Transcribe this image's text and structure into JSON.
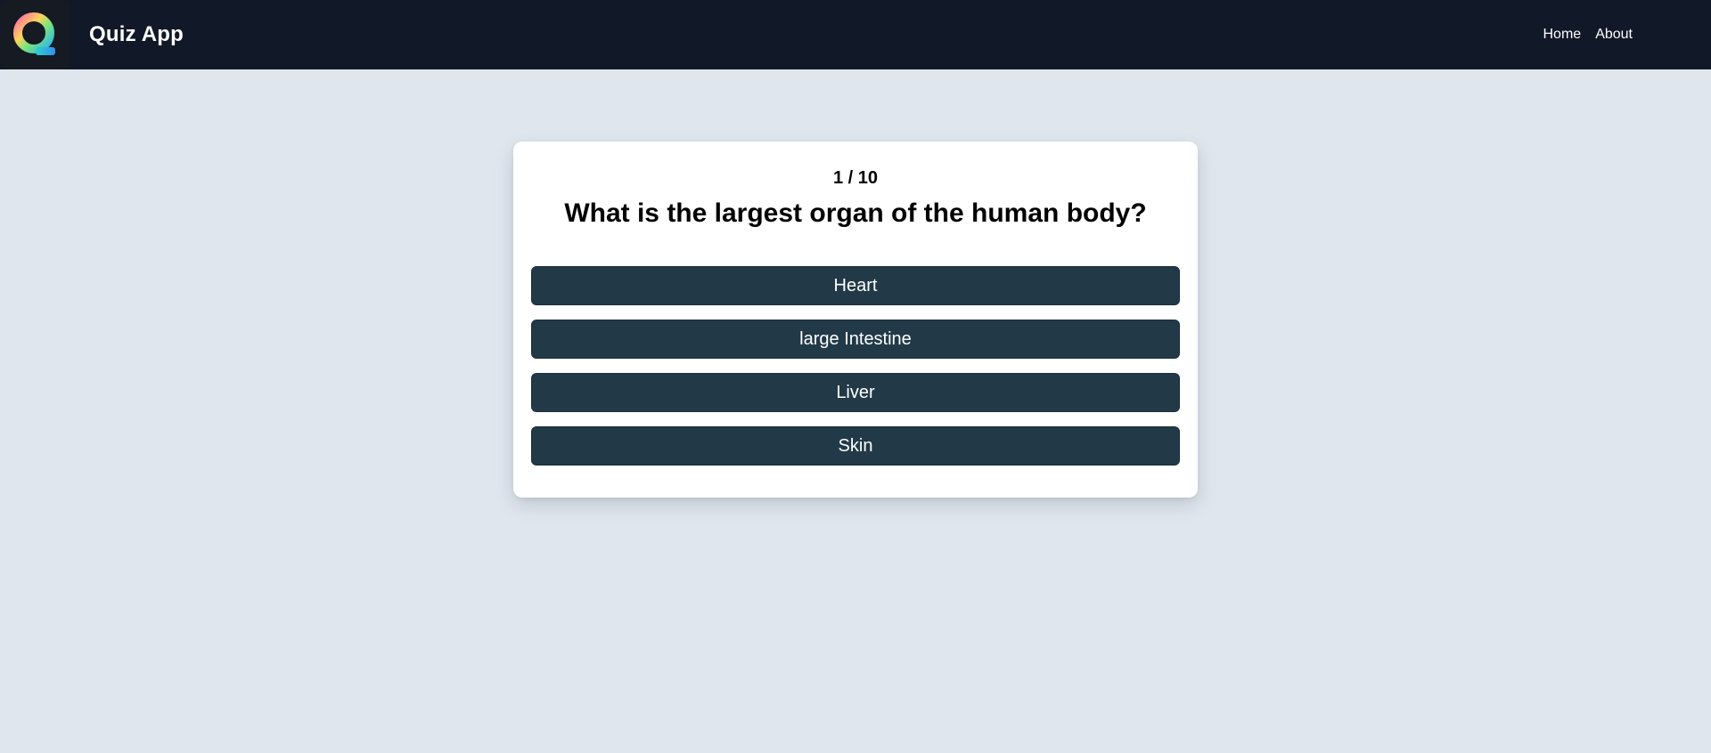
{
  "app": {
    "brand": "Quiz App",
    "logo_icon": "quiz-app-logo-icon"
  },
  "nav": {
    "links": [
      {
        "label": "Home"
      },
      {
        "label": "About"
      }
    ]
  },
  "quiz": {
    "progress": "1 / 10",
    "question": "What is the largest organ of the human body?",
    "options": [
      {
        "label": "Heart"
      },
      {
        "label": "large Intestine"
      },
      {
        "label": "Liver"
      },
      {
        "label": "Skin"
      }
    ]
  },
  "colors": {
    "navbar_bg": "#111827",
    "page_bg": "#dfe6ee",
    "option_bg": "#223a48",
    "card_bg": "#ffffff"
  }
}
